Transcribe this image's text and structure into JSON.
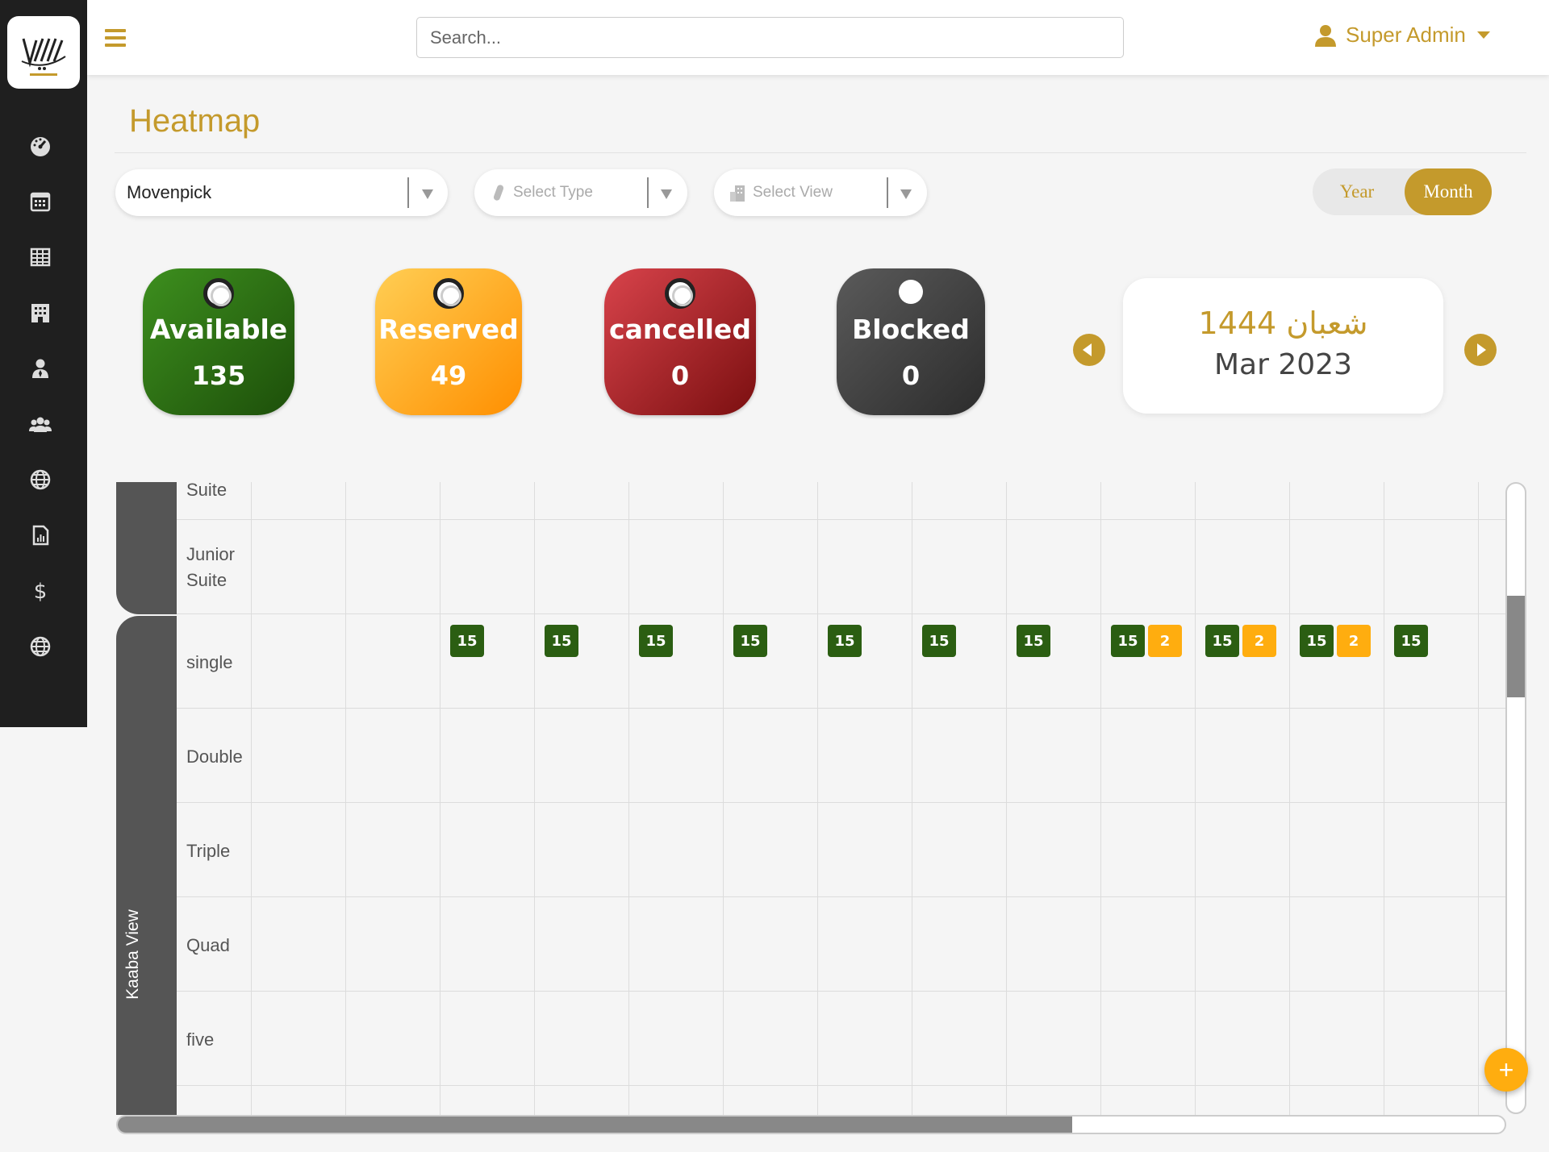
{
  "app": {
    "brand_color": "#c49a2c"
  },
  "header": {
    "search_placeholder": "Search...",
    "user_name": "Super Admin"
  },
  "sidebar": {
    "items": [
      {
        "icon": "dashboard-icon"
      },
      {
        "icon": "calendar-icon"
      },
      {
        "icon": "table-icon"
      },
      {
        "icon": "building-icon"
      },
      {
        "icon": "user-tie-icon"
      },
      {
        "icon": "users-icon"
      },
      {
        "icon": "globe-icon"
      },
      {
        "icon": "report-icon"
      },
      {
        "icon": "dollar-icon"
      },
      {
        "icon": "globe-icon"
      }
    ]
  },
  "page": {
    "title": "Heatmap"
  },
  "filters": {
    "hotel": "Movenpick",
    "type_placeholder": "Select Type",
    "view_placeholder": "Select View"
  },
  "toggle": {
    "year": "Year",
    "month": "Month",
    "active": "Month"
  },
  "stats": [
    {
      "label": "Available",
      "count": "135",
      "color": "#2b6e12"
    },
    {
      "label": "Reserved",
      "count": "49",
      "color": "#ffa31a"
    },
    {
      "label": "cancelled",
      "count": "0",
      "color": "#b4262d"
    },
    {
      "label": "Blocked",
      "count": "0",
      "color": "#444444"
    }
  ],
  "date": {
    "hijri": "شعبان 1444",
    "gregorian": "Mar 2023"
  },
  "grid": {
    "groups": [
      {
        "label": "Kaaba View"
      }
    ],
    "rows": [
      "Suite",
      "Junior Suite",
      "single",
      "Double",
      "Triple",
      "Quad",
      "five"
    ],
    "single_row_cells": [
      {
        "available": "15"
      },
      {
        "available": "15"
      },
      {
        "available": "15"
      },
      {
        "available": "15"
      },
      {
        "available": "15"
      },
      {
        "available": "15"
      },
      {
        "available": "15"
      },
      {
        "available": "15",
        "reserved": "2"
      },
      {
        "available": "15",
        "reserved": "2"
      },
      {
        "available": "15",
        "reserved": "2"
      },
      {
        "available": "15"
      }
    ],
    "available_color": "#2b5e12",
    "reserved_color": "#ffad0f"
  },
  "fab": {
    "label": "+"
  }
}
